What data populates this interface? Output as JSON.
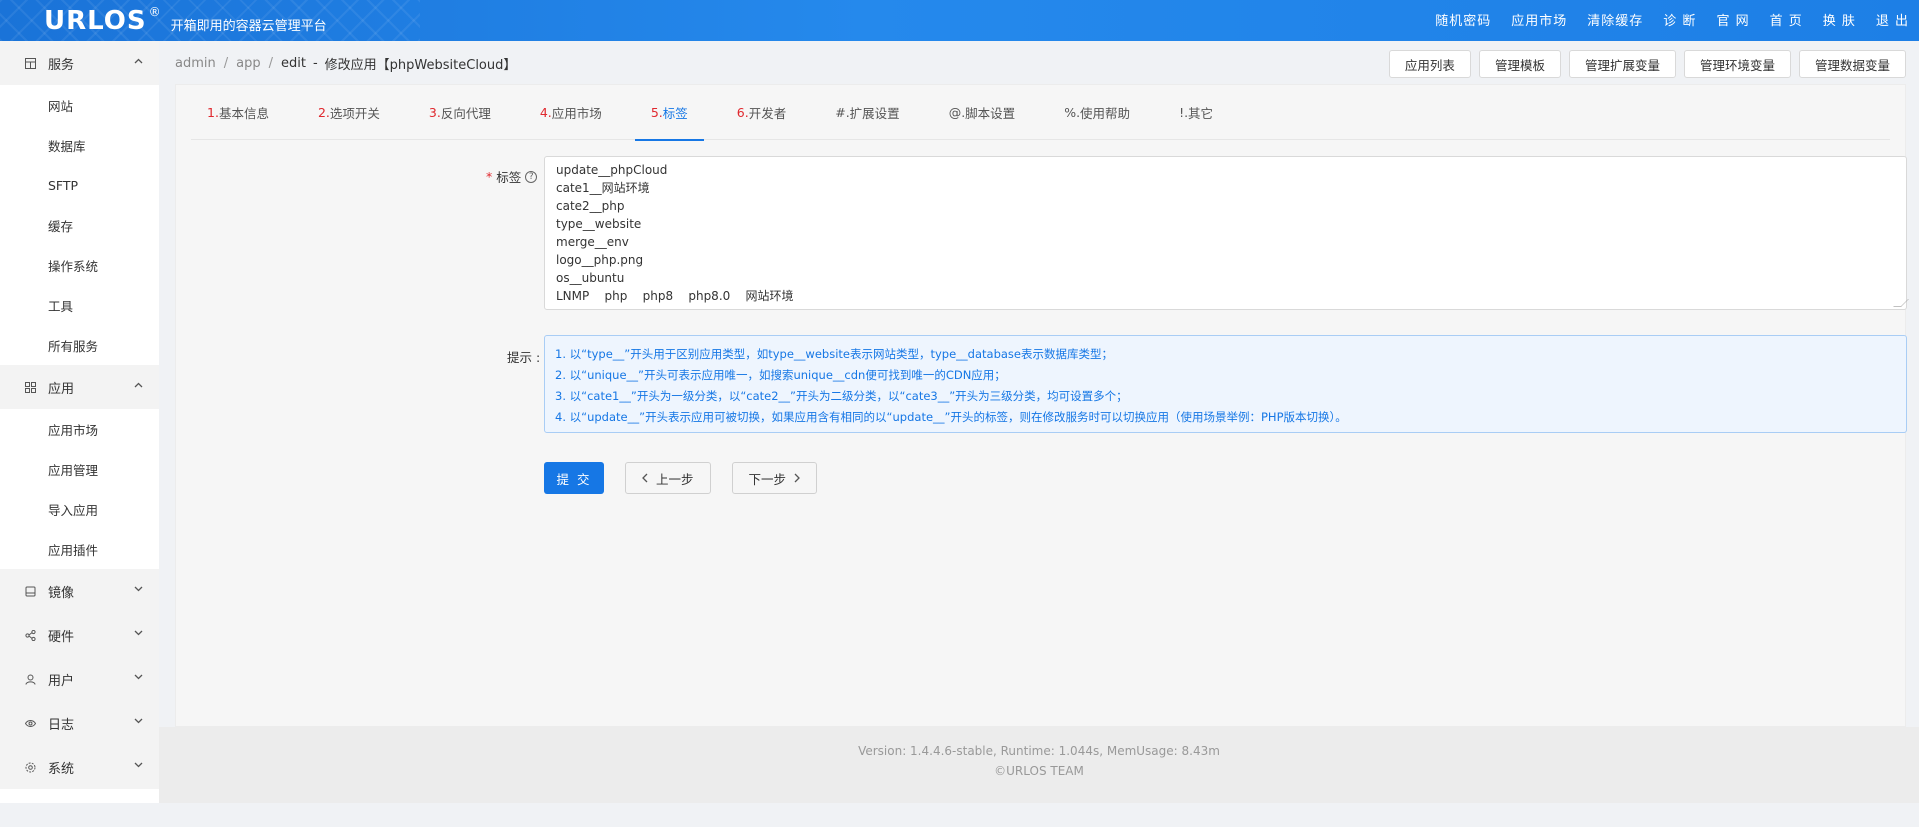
{
  "header": {
    "logo": "URLOS",
    "logo_reg": "®",
    "subtitle": "开箱即用的容器云管理平台",
    "nav": [
      "随机密码",
      "应用市场",
      "清除缓存",
      "诊 断",
      "官 网",
      "首 页",
      "换 肤",
      "退 出"
    ]
  },
  "sidebar": {
    "services": {
      "label": "服务",
      "items": [
        "网站",
        "数据库",
        "SFTP",
        "缓存",
        "操作系统",
        "工具",
        "所有服务"
      ]
    },
    "apps": {
      "label": "应用",
      "items": [
        "应用市场",
        "应用管理",
        "导入应用",
        "应用插件"
      ]
    },
    "collapsed": [
      {
        "label": "镜像",
        "icon": "image-icon"
      },
      {
        "label": "硬件",
        "icon": "share-icon"
      },
      {
        "label": "用户",
        "icon": "user-icon"
      },
      {
        "label": "日志",
        "icon": "eye-icon"
      },
      {
        "label": "系统",
        "icon": "gear-icon"
      }
    ]
  },
  "breadcrumb": {
    "items": [
      "admin",
      "app"
    ],
    "current": "edit",
    "dash": "-",
    "title": "修改应用【phpWebsiteCloud】"
  },
  "toolbar": [
    "应用列表",
    "管理模板",
    "管理扩展变量",
    "管理环境变量",
    "管理数据变量"
  ],
  "tabs": [
    {
      "num": "1.",
      "label": "基本信息"
    },
    {
      "num": "2.",
      "label": "选项开关"
    },
    {
      "num": "3.",
      "label": "反向代理"
    },
    {
      "num": "4.",
      "label": "应用市场"
    },
    {
      "num": "5.",
      "label": "标签"
    },
    {
      "num": "6.",
      "label": "开发者"
    },
    {
      "num": "#.",
      "label": "扩展设置"
    },
    {
      "num": "@.",
      "label": "脚本设置"
    },
    {
      "num": "%.",
      "label": "使用帮助"
    },
    {
      "num": "!.",
      "label": "其它"
    }
  ],
  "active_tab": 4,
  "form": {
    "tag_label": "标签",
    "required_mark": "*",
    "tag_value": "update__phpCloud\ncate1__网站环境\ncate2__php\ntype__website\nmerge__env\nlogo__php.png\nos__ubuntu\nLNMP    php    php8    php8.0    网站环境",
    "hint_label": "提示 :",
    "hints": [
      "1. 以“type__”开头用于区别应用类型，如type__website表示网站类型，type__database表示数据库类型；",
      "2. 以“unique__”开头可表示应用唯一，如搜索unique__cdn便可找到唯一的CDN应用；",
      "3. 以“cate1__”开头为一级分类，以“cate2__”开头为二级分类，以“cate3__”开头为三级分类，均可设置多个；",
      "4. 以“update__”开头表示应用可被切换，如果应用含有相同的以“update__”开头的标签，则在修改服务时可以切换应用（使用场景举例：PHP版本切换）。"
    ],
    "submit": "提 交",
    "prev": "上一步",
    "next": "下一步"
  },
  "footer": {
    "line1": "Version: 1.4.4.6-stable,    Runtime: 1.044s,    MemUsage: 8.43m",
    "line2": "©URLOS TEAM"
  },
  "colors": {
    "primary": "#1677e5",
    "required": "#e0282e",
    "header": "#1f7fe6"
  }
}
